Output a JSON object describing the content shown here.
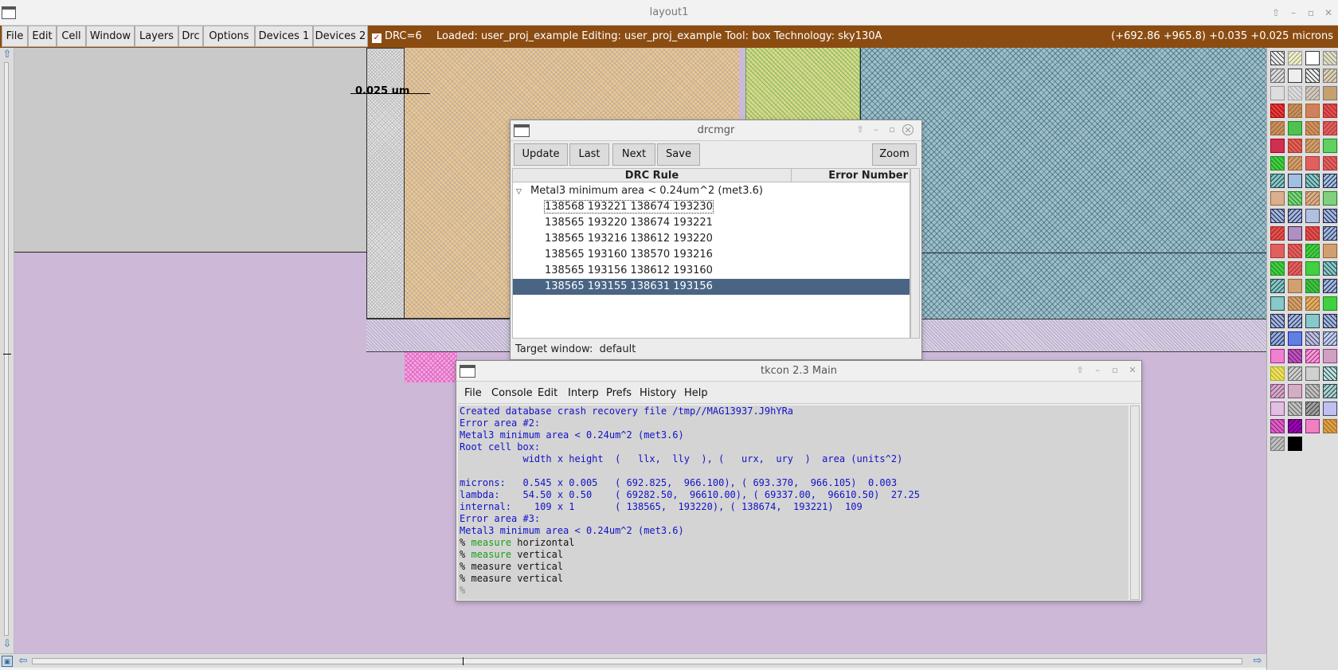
{
  "window": {
    "title": "layout1"
  },
  "menubar": {
    "items": [
      "File",
      "Edit",
      "Cell",
      "Window",
      "Layers",
      "Drc",
      "Options",
      "Devices 1",
      "Devices 2"
    ],
    "drc_badge": "DRC=6",
    "status": "Loaded: user_proj_example Editing: user_proj_example Tool: box  Technology: sky130A",
    "coords": "(+692.86 +965.8) +0.035 +0.025 microns"
  },
  "canvas": {
    "ruler_label": "0.025 um"
  },
  "drcmgr": {
    "title": "drcmgr",
    "buttons": {
      "update": "Update",
      "last": "Last",
      "next": "Next",
      "save": "Save",
      "zoom": "Zoom"
    },
    "columns": {
      "rule": "DRC Rule",
      "error_number": "Error Number"
    },
    "rule_label": "Metal3 minimum area < 0.24um^2 (met3.6)",
    "rows": [
      "138568 193221 138674 193230",
      "138565 193220 138674 193221",
      "138565 193216 138612 193220",
      "138565 193160 138570 193216",
      "138565 193156 138612 193160",
      "138565 193155 138631 193156"
    ],
    "target_label": "Target window:",
    "target_value": "default"
  },
  "tkcon": {
    "title": "tkcon 2.3 Main",
    "menu": [
      "File",
      "Console",
      "Edit",
      "Interp",
      "Prefs",
      "History",
      "Help"
    ],
    "lines": {
      "l1": "Created database crash recovery file /tmp//MAG13937.J9hYRa",
      "l2": "Error area #2:",
      "l3": "Metal3 minimum area < 0.24um^2 (met3.6)",
      "l4": "Root cell box:",
      "l5": "           width x height  (   llx,  lly  ), (   urx,  ury  )  area (units^2)",
      "l6": "",
      "l7": "microns:   0.545 x 0.005   ( 692.825,  966.100), ( 693.370,  966.105)  0.003",
      "l8": "lambda:    54.50 x 0.50    ( 69282.50,  96610.00), ( 69337.00,  96610.50)  27.25",
      "l9": "internal:    109 x 1       ( 138565,  193220), ( 138674,  193221)  109",
      "l10": "Error area #3:",
      "l11": "Metal3 minimum area < 0.24um^2 (met3.6)"
    },
    "prompt": "%",
    "commands": [
      {
        "cmd": "measure",
        "arg": "horizontal"
      },
      {
        "cmd": "measure",
        "arg": "vertical"
      },
      {
        "cmd": "measure",
        "arg": "vertical"
      },
      {
        "cmd": "measure",
        "arg": "vertical"
      }
    ]
  },
  "colors": {
    "menubar_bg": "#8b4c12",
    "selection": "#4a6484",
    "console_text": "#1212c8",
    "console_cmd": "#19a019"
  },
  "icons": {
    "scroll_up": "arrow-up-icon",
    "scroll_down": "arrow-down-icon",
    "scroll_left": "arrow-left-icon",
    "scroll_right": "arrow-right-icon"
  }
}
